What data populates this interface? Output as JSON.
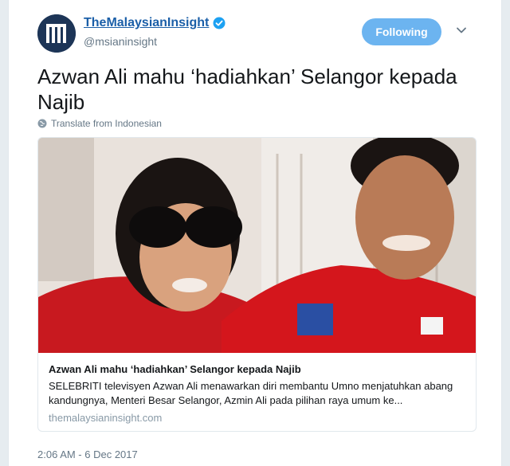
{
  "account": {
    "display_name": "TheMalaysianInsight",
    "handle": "@msianinsight"
  },
  "follow_button": {
    "label": "Following"
  },
  "tweet": {
    "text": "Azwan Ali mahu ‘hadiahkan’ Selangor kepada Najib",
    "translate_label": "Translate from Indonesian",
    "timestamp": "2:06 AM - 6 Dec 2017"
  },
  "card": {
    "title": "Azwan Ali mahu ‘hadiahkan’ Selangor kepada Najib",
    "description": "SELEBRITI televisyen Azwan Ali menawarkan diri membantu Umno menjatuhkan abang kandungnya, Menteri Besar Selangor, Azmin Ali pada pilihan raya umum ke...",
    "domain": "themalaysianinsight.com"
  },
  "icons": {
    "avatar": "malaysian-insight-logo",
    "verified": "verified-badge-icon",
    "menu": "chevron-down-icon",
    "translate": "globe-icon"
  },
  "colors": {
    "link": "#1b5fa8",
    "follow_button": "#6cb4f0",
    "verified": "#1da1f2",
    "muted_text": "#657786"
  }
}
